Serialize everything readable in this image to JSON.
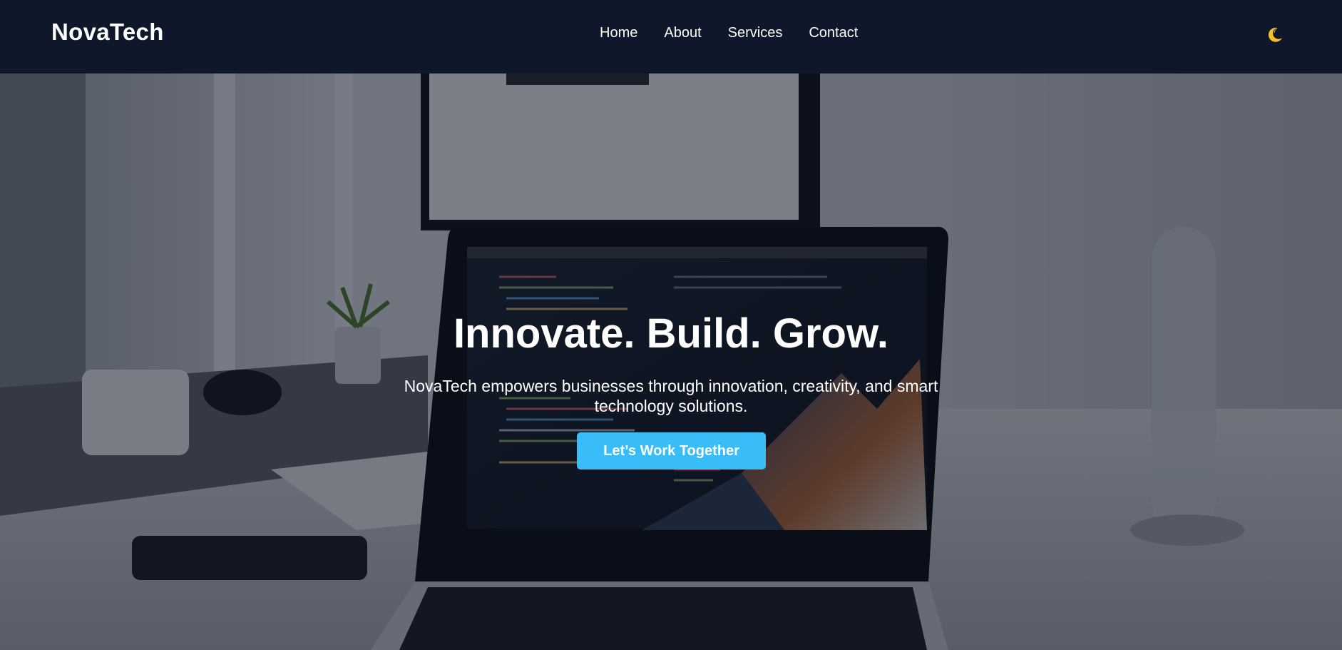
{
  "navbar": {
    "brand": "NovaTech",
    "links": [
      "Home",
      "About",
      "Services",
      "Contact"
    ],
    "theme_toggle_icon": "moon-icon",
    "theme_toggle_color": "#fbbf24",
    "background": "#0f172a"
  },
  "hero": {
    "title": "Innovate. Build. Grow.",
    "subtitle": "NovaTech empowers businesses through innovation, creativity, and smart technology solutions.",
    "cta_label": "Let’s Work Together",
    "cta_color": "#38bdf8",
    "background_image": "workspace-laptop-photo"
  }
}
